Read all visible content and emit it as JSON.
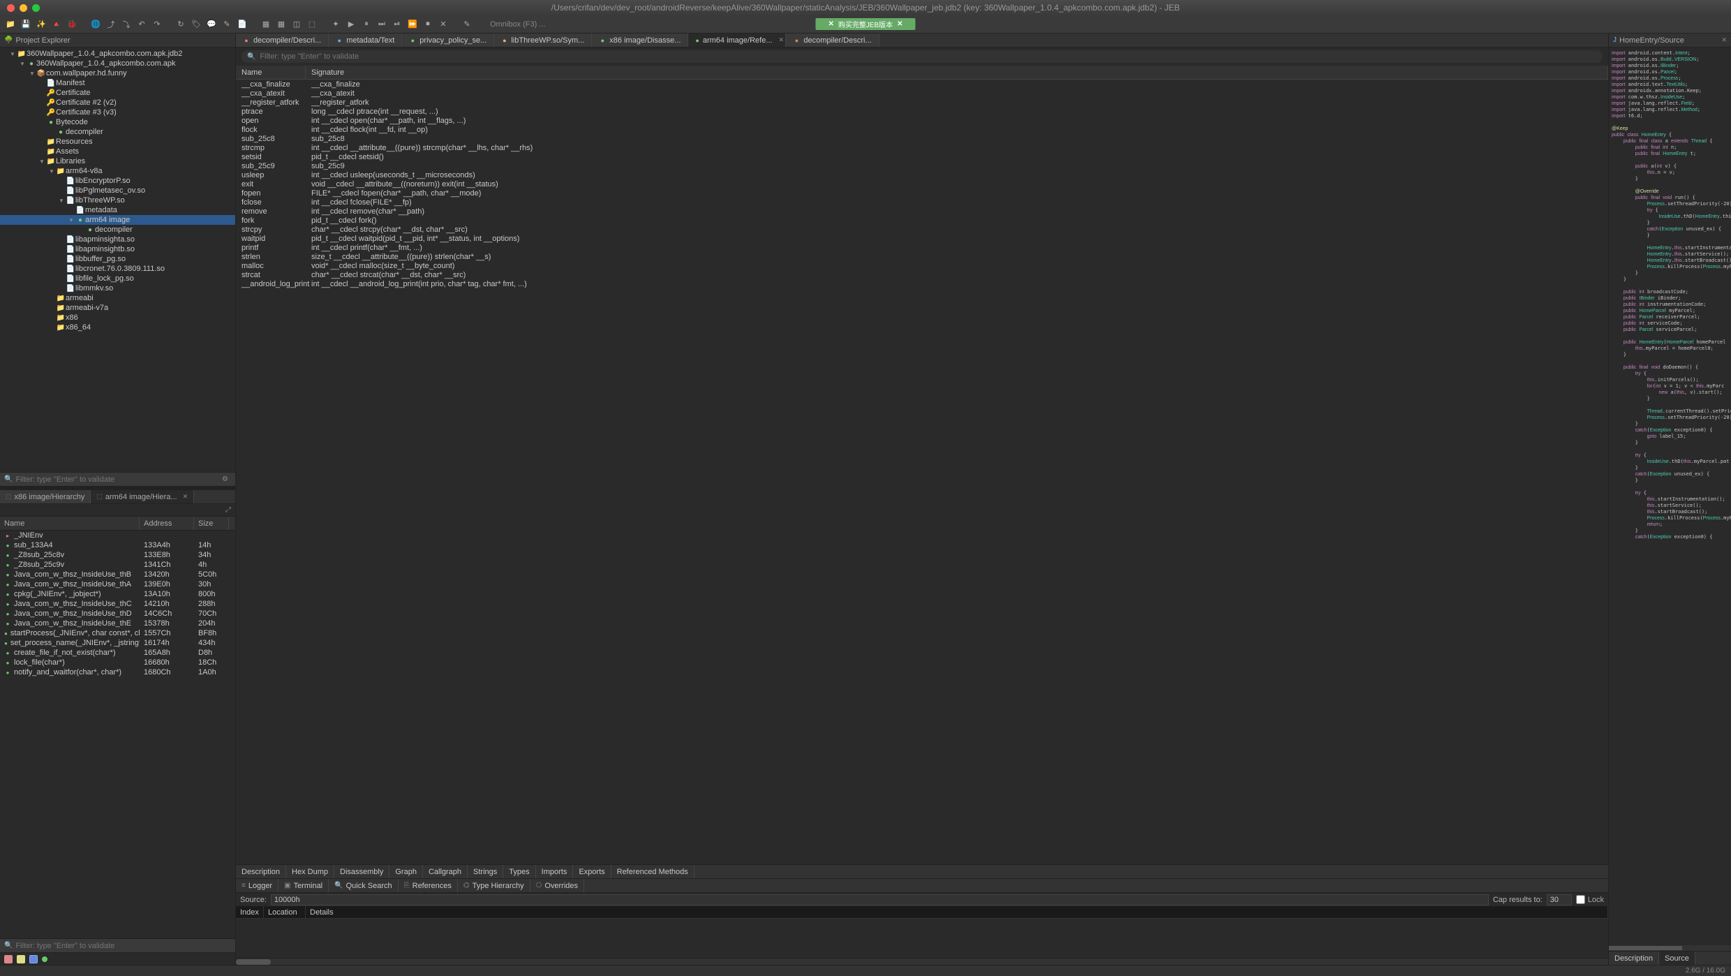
{
  "window_title": "/Users/crifan/dev/dev_root/androidReverse/keepAlive/360Wallpaper/staticAnalysis/JEB/360Wallpaper_jeb.jdb2 (key: 360Wallpaper_1.0.4_apkcombo.com.apk.jdb2) - JEB",
  "omnibox": "Omnibox (F3) ...",
  "banner": "购买完整JEB版本",
  "project_explorer": {
    "title": "Project Explorer",
    "filter_placeholder": "Filter: type \"Enter\" to validate",
    "tree": [
      {
        "indent": 0,
        "arrow": "▼",
        "icon": "📁",
        "color": "",
        "label": "360Wallpaper_1.0.4_apkcombo.com.apk.jdb2"
      },
      {
        "indent": 1,
        "arrow": "▼",
        "icon": "●",
        "color": "green",
        "label": "360Wallpaper_1.0.4_apkcombo.com.apk"
      },
      {
        "indent": 2,
        "arrow": "▼",
        "icon": "📦",
        "color": "",
        "label": "com.wallpaper.hd.funny"
      },
      {
        "indent": 3,
        "arrow": "",
        "icon": "📄",
        "color": "file",
        "label": "Manifest"
      },
      {
        "indent": 3,
        "arrow": "",
        "icon": "🔑",
        "color": "",
        "label": "Certificate"
      },
      {
        "indent": 3,
        "arrow": "",
        "icon": "🔑",
        "color": "",
        "label": "Certificate #2 (v2)"
      },
      {
        "indent": 3,
        "arrow": "",
        "icon": "🔑",
        "color": "",
        "label": "Certificate #3 (v3)"
      },
      {
        "indent": 3,
        "arrow": "",
        "icon": "●",
        "color": "green",
        "label": "Bytecode"
      },
      {
        "indent": 4,
        "arrow": "",
        "icon": "●",
        "color": "green",
        "label": "decompiler"
      },
      {
        "indent": 3,
        "arrow": "",
        "icon": "📁",
        "color": "",
        "label": "Resources"
      },
      {
        "indent": 3,
        "arrow": "",
        "icon": "📁",
        "color": "",
        "label": "Assets"
      },
      {
        "indent": 3,
        "arrow": "▼",
        "icon": "📁",
        "color": "",
        "label": "Libraries"
      },
      {
        "indent": 4,
        "arrow": "▼",
        "icon": "📁",
        "color": "",
        "label": "arm64-v8a"
      },
      {
        "indent": 5,
        "arrow": "",
        "icon": "📄",
        "color": "file",
        "label": "libEncryptorP.so"
      },
      {
        "indent": 5,
        "arrow": "",
        "icon": "📄",
        "color": "file",
        "label": "libPglmetasec_ov.so"
      },
      {
        "indent": 5,
        "arrow": "▼",
        "icon": "📄",
        "color": "file",
        "label": "libThreeWP.so"
      },
      {
        "indent": 6,
        "arrow": "",
        "icon": "📄",
        "color": "blue",
        "label": "metadata"
      },
      {
        "indent": 6,
        "arrow": "▼",
        "icon": "●",
        "color": "green",
        "label": "arm64 image",
        "selected": true
      },
      {
        "indent": 7,
        "arrow": "",
        "icon": "●",
        "color": "green",
        "label": "decompiler"
      },
      {
        "indent": 5,
        "arrow": "",
        "icon": "📄",
        "color": "file",
        "label": "libapminsighta.so"
      },
      {
        "indent": 5,
        "arrow": "",
        "icon": "📄",
        "color": "file",
        "label": "libapminsightb.so"
      },
      {
        "indent": 5,
        "arrow": "",
        "icon": "📄",
        "color": "file",
        "label": "libbuffer_pg.so"
      },
      {
        "indent": 5,
        "arrow": "",
        "icon": "📄",
        "color": "file",
        "label": "libcronet.76.0.3809.111.so"
      },
      {
        "indent": 5,
        "arrow": "",
        "icon": "📄",
        "color": "file",
        "label": "libfile_lock_pg.so"
      },
      {
        "indent": 5,
        "arrow": "",
        "icon": "📄",
        "color": "file",
        "label": "libmmkv.so"
      },
      {
        "indent": 4,
        "arrow": "",
        "icon": "📁",
        "color": "",
        "label": "armeabi"
      },
      {
        "indent": 4,
        "arrow": "",
        "icon": "📁",
        "color": "",
        "label": "armeabi-v7a"
      },
      {
        "indent": 4,
        "arrow": "",
        "icon": "📁",
        "color": "",
        "label": "x86"
      },
      {
        "indent": 4,
        "arrow": "",
        "icon": "📁",
        "color": "",
        "label": "x86_64"
      }
    ]
  },
  "hierarchy": {
    "tabs": [
      {
        "label": "x86 image/Hierarchy",
        "active": false
      },
      {
        "label": "arm64 image/Hiera...",
        "active": true,
        "closable": true
      }
    ],
    "columns": {
      "name": "Name",
      "addr": "Address",
      "size": "Size"
    },
    "filter_placeholder": "Filter: type \"Enter\" to validate",
    "rows": [
      {
        "name": "_JNIEnv",
        "addr": "",
        "size": ""
      },
      {
        "name": "sub_133A4",
        "addr": "133A4h",
        "size": "14h"
      },
      {
        "name": "_Z8sub_25c8v",
        "addr": "133E8h",
        "size": "34h"
      },
      {
        "name": "_Z8sub_25c9v",
        "addr": "1341Ch",
        "size": "4h"
      },
      {
        "name": "Java_com_w_thsz_InsideUse_thB",
        "addr": "13420h",
        "size": "5C0h"
      },
      {
        "name": "Java_com_w_thsz_InsideUse_thA",
        "addr": "139E0h",
        "size": "30h"
      },
      {
        "name": "cpkg(_JNIEnv*, _jobject*)",
        "addr": "13A10h",
        "size": "800h"
      },
      {
        "name": "Java_com_w_thsz_InsideUse_thC",
        "addr": "14210h",
        "size": "288h"
      },
      {
        "name": "Java_com_w_thsz_InsideUse_thD",
        "addr": "14C6Ch",
        "size": "70Ch"
      },
      {
        "name": "Java_com_w_thsz_InsideUse_thE",
        "addr": "15378h",
        "size": "204h"
      },
      {
        "name": "startProcess(_JNIEnv*, char const*, char",
        "addr": "1557Ch",
        "size": "BF8h"
      },
      {
        "name": "set_process_name(_JNIEnv*, _jstring*)",
        "addr": "16174h",
        "size": "434h"
      },
      {
        "name": "create_file_if_not_exist(char*)",
        "addr": "165A8h",
        "size": "D8h"
      },
      {
        "name": "lock_file(char*)",
        "addr": "16680h",
        "size": "18Ch"
      },
      {
        "name": "notify_and_waitfor(char*, char*)",
        "addr": "1680Ch",
        "size": "1A0h"
      }
    ]
  },
  "editor_tabs": [
    {
      "icon": "●",
      "color": "red",
      "label": "decompiler/Descri...",
      "active": false
    },
    {
      "icon": "●",
      "color": "blue",
      "label": "metadata/Text",
      "active": false
    },
    {
      "icon": "●",
      "color": "green",
      "label": "privacy_policy_se...",
      "active": false
    },
    {
      "icon": "●",
      "color": "orange",
      "label": "libThreeWP.so/Sym...",
      "active": false
    },
    {
      "icon": "●",
      "color": "green",
      "label": "x86 image/Disasse...",
      "active": false
    },
    {
      "icon": "●",
      "color": "green",
      "label": "arm64 image/Refe...",
      "active": true,
      "closable": true
    },
    {
      "icon": "●",
      "color": "red",
      "label": "decompiler/Descri...",
      "active": false
    }
  ],
  "functions": {
    "filter_placeholder": "Filter: type \"Enter\" to validate",
    "columns": {
      "name": "Name",
      "sig": "Signature"
    },
    "rows": [
      {
        "name": "__cxa_finalize",
        "sig": "__cxa_finalize"
      },
      {
        "name": "__cxa_atexit",
        "sig": "__cxa_atexit"
      },
      {
        "name": "__register_atfork",
        "sig": "__register_atfork"
      },
      {
        "name": "ptrace",
        "sig": "long __cdecl ptrace(int __request, ...)"
      },
      {
        "name": "open",
        "sig": "int __cdecl open(char* __path, int __flags, ...)"
      },
      {
        "name": "flock",
        "sig": "int __cdecl flock(int __fd, int __op)"
      },
      {
        "name": "sub_25c8",
        "sig": "sub_25c8"
      },
      {
        "name": "strcmp",
        "sig": "int __cdecl __attribute__((pure)) strcmp(char* __lhs, char* __rhs)"
      },
      {
        "name": "setsid",
        "sig": "pid_t __cdecl setsid()"
      },
      {
        "name": "sub_25c9",
        "sig": "sub_25c9"
      },
      {
        "name": "usleep",
        "sig": "int __cdecl usleep(useconds_t __microseconds)"
      },
      {
        "name": "exit",
        "sig": "void __cdecl __attribute__((noreturn)) exit(int __status)"
      },
      {
        "name": "fopen",
        "sig": "FILE* __cdecl fopen(char* __path, char* __mode)"
      },
      {
        "name": "fclose",
        "sig": "int __cdecl fclose(FILE* __fp)"
      },
      {
        "name": "remove",
        "sig": "int __cdecl remove(char* __path)"
      },
      {
        "name": "fork",
        "sig": "pid_t __cdecl fork()"
      },
      {
        "name": "strcpy",
        "sig": "char* __cdecl strcpy(char* __dst, char* __src)"
      },
      {
        "name": "waitpid",
        "sig": "pid_t __cdecl waitpid(pid_t __pid, int* __status, int __options)"
      },
      {
        "name": "printf",
        "sig": "int __cdecl printf(char* __fmt, ...)"
      },
      {
        "name": "strlen",
        "sig": "size_t __cdecl __attribute__((pure)) strlen(char* __s)"
      },
      {
        "name": "malloc",
        "sig": "void* __cdecl malloc(size_t __byte_count)"
      },
      {
        "name": "strcat",
        "sig": "char* __cdecl strcat(char* __dst, char* __src)"
      },
      {
        "name": "__android_log_print",
        "sig": "int __cdecl __android_log_print(int prio, char* tag, char* fmt, ...)"
      }
    ]
  },
  "bottom_tabs": [
    "Description",
    "Hex Dump",
    "Disassembly",
    "Graph",
    "Callgraph",
    "Strings",
    "Types",
    "Imports",
    "Exports",
    "Referenced Methods"
  ],
  "log_tabs": [
    "Logger",
    "Terminal",
    "Quick Search",
    "References",
    "Type Hierarchy",
    "Overrides"
  ],
  "source_bar": {
    "label": "Source:",
    "value": "10000h",
    "cap_label": "Cap results to:",
    "cap_value": "30",
    "lock_label": "Lock"
  },
  "log_columns": {
    "idx": "Index",
    "loc": "Location",
    "det": "Details"
  },
  "right": {
    "title": "HomeEntry/Source",
    "bottom_tabs": [
      "Description",
      "Source"
    ]
  },
  "code": "import android.content.Intent;\nimport android.os.Build.VERSION;\nimport android.os.IBinder;\nimport android.os.Parcel;\nimport android.os.Process;\nimport android.text.TextUtils;\nimport androidx.annotation.Keep;\nimport com.w.thsz.InsideUse;\nimport java.lang.reflect.Field;\nimport java.lang.reflect.Method;\nimport t6.d;\n\n@Keep\npublic class HomeEntry {\n    public final class a extends Thread {\n        public final int n;\n        public final HomeEntry t;\n\n        public a(int v) {\n            this.n = v;\n        }\n\n        @Override\n        public final void run() {\n            Process.setThreadPriority(-20);\n            try {\n                InsideUse.thD(HomeEntry.thi\n            }\n            catch(Exception unused_ex) {\n            }\n\n            HomeEntry.this.startInstrumenta\n            HomeEntry.this.startService();\n            HomeEntry.this.startBroadcast()\n            Process.killProcess(Process.myP\n        }\n    }\n\n    public int broadcastCode;\n    public IBinder iBinder;\n    public int instrumentationCode;\n    public HomeParcel myParcel;\n    public Parcel receiverParcel;\n    public int serviceCode;\n    public Parcel serviceParcel;\n\n    public HomeEntry(HomeParcel homeParcel\n        this.myParcel = homeParcel0;\n    }\n\n    public final void doDaemon() {\n        try {\n            this.initParcels();\n            for(int v = 1; v < this.myParc\n                new a(this, v).start();\n            }\n\n            Thread.currentThread().setPrior\n            Process.setThreadPriority(-20);\n        }\n        catch(Exception exception0) {\n            goto label_15;\n        }\n\n        try {\n            InsideUse.thD(this.myParcel.pat\n        }\n        catch(Exception unused_ex) {\n        }\n\n        try {\n            this.startInstrumentation();\n            this.startService();\n            this.startBroadcast();\n            Process.killProcess(Process.myP\n            return;\n        }\n        catch(Exception exception0) {",
  "statusbar": "2.6G / 16.0G"
}
